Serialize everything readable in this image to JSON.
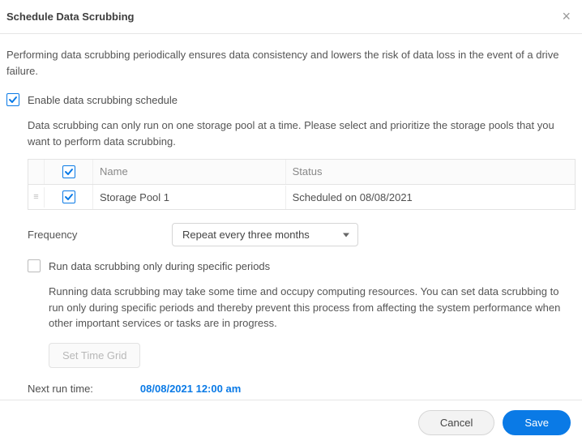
{
  "title": "Schedule Data Scrubbing",
  "intro": "Performing data scrubbing periodically ensures data consistency and lowers the risk of data loss in the event of a drive failure.",
  "enable": {
    "label": "Enable data scrubbing schedule",
    "checked": true
  },
  "pool_intro": "Data scrubbing can only run on one storage pool at a time. Please select and prioritize the storage pools that you want to perform data scrubbing.",
  "table": {
    "columns": {
      "name": "Name",
      "status": "Status"
    },
    "rows": [
      {
        "checked": true,
        "name": "Storage Pool 1",
        "status": "Scheduled on 08/08/2021"
      }
    ]
  },
  "frequency": {
    "label": "Frequency",
    "selected": "Repeat every three months"
  },
  "periods": {
    "label": "Run data scrubbing only during specific periods",
    "checked": false,
    "description": "Running data scrubbing may take some time and occupy computing resources. You can set data scrubbing to run only during specific periods and thereby prevent this process from affecting the system performance when other important services or tasks are in progress.",
    "button": "Set Time Grid"
  },
  "next_run": {
    "label": "Next run time:",
    "value": "08/08/2021 12:00 am"
  },
  "footer": {
    "cancel": "Cancel",
    "save": "Save"
  }
}
